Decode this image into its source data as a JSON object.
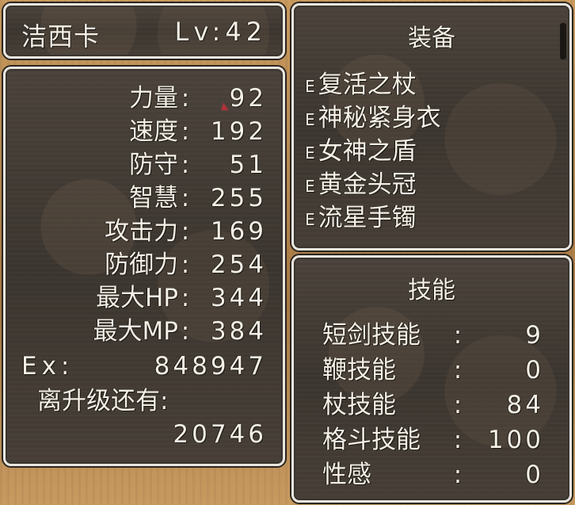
{
  "character": {
    "name": "洁西卡",
    "level_label": "Lv:",
    "level": "42"
  },
  "stats": [
    {
      "label": "力量",
      "value": "92"
    },
    {
      "label": "速度",
      "value": "192"
    },
    {
      "label": "防守",
      "value": "51"
    },
    {
      "label": "智慧",
      "value": "255"
    },
    {
      "label": "攻击力",
      "value": "169"
    },
    {
      "label": "防御力",
      "value": "254"
    },
    {
      "label": "最大HP",
      "value": "344"
    },
    {
      "label": "最大MP",
      "value": "384"
    }
  ],
  "colon": ":",
  "experience": {
    "label": "Ex:",
    "value": "848947",
    "next_label": "离升级还有:",
    "next_value": "20746"
  },
  "equipment": {
    "title": "装备",
    "equipped_mark": "E",
    "items": [
      "复活之杖",
      "神秘紧身衣",
      "女神之盾",
      "黄金头冠",
      "流星手镯"
    ]
  },
  "skills": {
    "title": "技能",
    "items": [
      {
        "name": "短剑技能",
        "value": "9"
      },
      {
        "name": "鞭技能",
        "value": "0"
      },
      {
        "name": "杖技能",
        "value": "84"
      },
      {
        "name": "格斗技能",
        "value": "100"
      },
      {
        "name": "性感",
        "value": "0"
      }
    ]
  },
  "colors": {
    "panel_bg": "#3f3832",
    "panel_border": "#e9e6df",
    "text": "#f4f0e6",
    "cursor": "#c0303a"
  }
}
